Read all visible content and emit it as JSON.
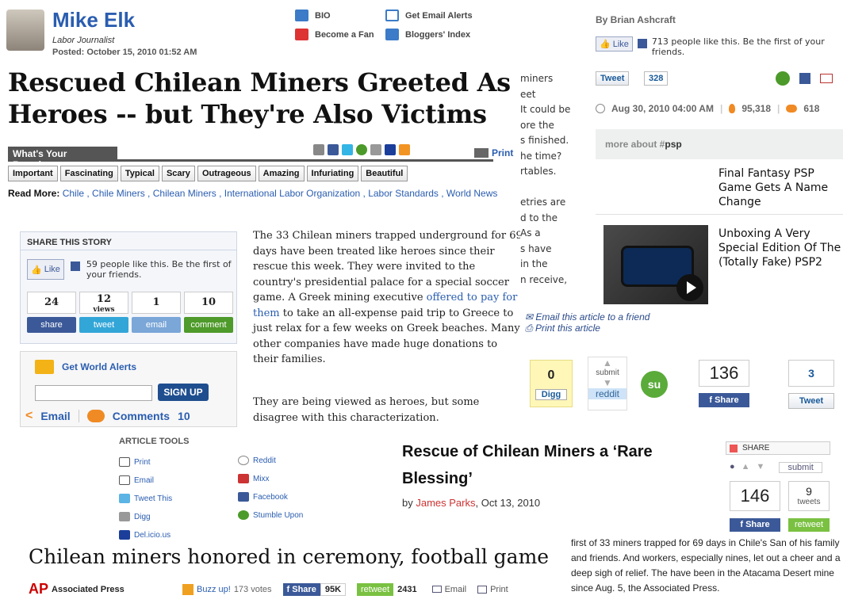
{
  "panelA": {
    "author": "Mike Elk",
    "role": "Labor Journalist",
    "posted": "Posted: October 15, 2010 01:52 AM",
    "links": {
      "bio": "BIO",
      "alerts": "Get Email Alerts",
      "fan": "Become a Fan",
      "bloggers": "Bloggers' Index"
    },
    "headline": "Rescued Chilean Miners Greeted As Heroes -- but They're Also Victims",
    "reaction_label": "What's Your Reaction:",
    "print": "Print",
    "reactions": [
      "Important",
      "Fascinating",
      "Typical",
      "Scary",
      "Outrageous",
      "Amazing",
      "Infuriating",
      "Beautiful"
    ],
    "read_more_label": "Read More:",
    "read_more": "Chile , Chile Miners , Chilean Miners , International Labor Organization , Labor Standards , World News"
  },
  "panelB": {
    "share_title": "SHARE THIS STORY",
    "like": "Like",
    "like_text": "59 people like this. Be the first of your friends.",
    "counts": [
      "24",
      "12",
      "1",
      "10"
    ],
    "views_label": "views",
    "buttons": [
      "share",
      "tweet",
      "email",
      "comment"
    ],
    "alerts_title": "Get World Alerts",
    "signup": "SIGN UP",
    "email": "Email",
    "comments": "Comments",
    "comments_count": "10",
    "para1_a": "The 33 Chilean miners trapped underground for 69 days have been treated like heroes since their rescue this week. They were invited to the country's presidential palace for a special soccer game. A Greek mining executive ",
    "para1_link": "offered to pay for them",
    "para1_b": " to take an all-expense paid trip to Greece to just relax for a few weeks on Greek beaches. Many other companies have made huge donations to their families.",
    "para2": "They are being viewed as heroes, but some disagree with this characterization."
  },
  "panelC": {
    "fragments": [
      "miners",
      "eet",
      "It could be",
      "ore the",
      "s finished.",
      "he time?",
      "rtables.",
      "",
      "etries are",
      "d to the",
      "As a",
      "s have",
      "in the",
      "n receive,"
    ],
    "byline": "By Brian Ashcraft",
    "like": "Like",
    "like_text": "713 people like this. Be the first of your friends.",
    "tweet": "Tweet",
    "tweet_count": "328",
    "date": "Aug 30, 2010 04:00 AM",
    "views": "95,318",
    "comments": "618",
    "more_about": "more about #",
    "more_tag": "psp",
    "related1": "Final Fantasy PSP Game Gets A Name Change",
    "related2": "Unboxing A Very Special Edition Of The (Totally Fake) PSP2"
  },
  "panelD": {
    "email_article": "Email this article to a friend",
    "print_article": "Print this article",
    "digg_count": "0",
    "digg": "Digg",
    "submit": "submit",
    "reddit": "reddit",
    "fb_count": "136",
    "share": "Share",
    "tw_count": "3",
    "tweet": "Tweet"
  },
  "panelE": {
    "title": "ARTICLE TOOLS",
    "left": [
      "Print",
      "Email",
      "Tweet This",
      "Digg",
      "Del.icio.us"
    ],
    "right": [
      "Reddit",
      "Mixx",
      "Facebook",
      "Stumble Upon"
    ]
  },
  "panelF": {
    "headline": "Rescue of Chilean Miners a ‘Rare Blessing’",
    "by": "by ",
    "author": "James Parks",
    "date": ", Oct 13, 2010",
    "share": "SHARE",
    "submit": "submit",
    "fb_count": "146",
    "tweet_count": "9",
    "tweets_label": "tweets",
    "share_btn": "Share",
    "retweet": "retweet"
  },
  "panelG": {
    "headline": "Chilean miners honored in ceremony, football game",
    "source": "Associated Press",
    "buzz": "Buzz up!",
    "votes": "173 votes",
    "share": "Share",
    "share_count": "95K",
    "retweet": "retweet",
    "retweet_count": "2431",
    "email": "Email",
    "print": "Print"
  },
  "panelH": {
    "text": "first of 33 miners trapped for 69 days in Chile's San of his family and friends. And workers, especially nines, let out a cheer and a deep sigh of relief. The have been in the Atacama Desert mine since Aug. 5, the Associated Press."
  }
}
